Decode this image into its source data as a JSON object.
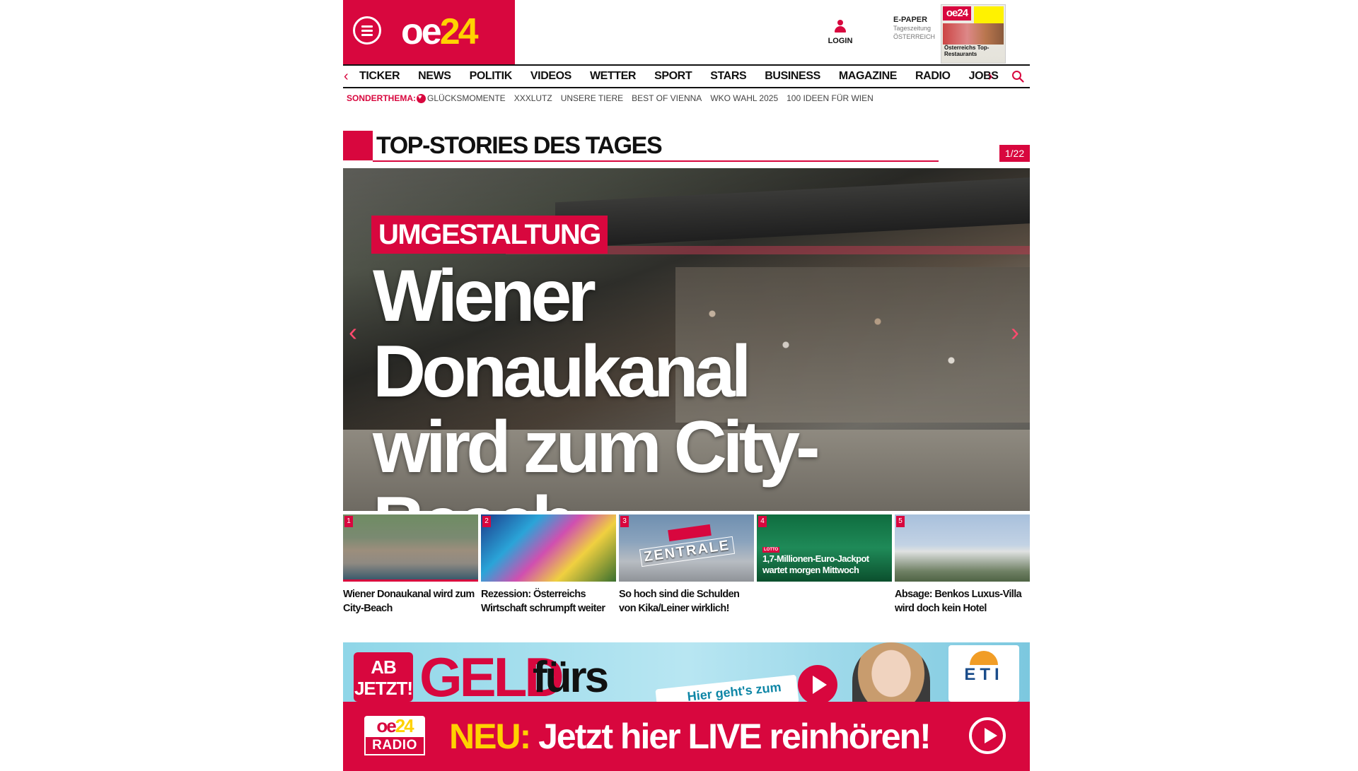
{
  "header": {
    "logo": {
      "part1": "oe",
      "part2": "24"
    },
    "login_label": "LOGIN",
    "epaper": {
      "title": "E-PAPER",
      "line1": "Tageszeitung",
      "line2": "ÖSTERREICH"
    },
    "epaper_cover_logo": "oe24",
    "epaper_cover_headline": "Österreichs Top-Restaurants"
  },
  "nav": {
    "items": [
      "TICKER",
      "NEWS",
      "POLITIK",
      "VIDEOS",
      "WETTER",
      "SPORT",
      "STARS",
      "BUSINESS",
      "MAGAZINE",
      "RADIO",
      "JOBS"
    ]
  },
  "subnav": {
    "label": "SONDERTHEMA:",
    "items": [
      "GLÜCKSMOMENTE",
      "XXXLUTZ",
      "UNSERE TIERE",
      "BEST OF VIENNA",
      "WKO WAHL 2025",
      "100 IDEEN FÜR WIEN"
    ]
  },
  "section": {
    "title": "TOP-STORIES DES TAGES",
    "counter": "1/22"
  },
  "hero": {
    "tag": "UMGESTALTUNG",
    "headline_line1": "Wiener",
    "headline_line2": "Donaukanal",
    "headline_line3": "wird zum City-Beach"
  },
  "thumbs": [
    {
      "num": "1",
      "caption": "Wiener Donaukanal wird zum City-Beach"
    },
    {
      "num": "2",
      "caption": "Rezession: Österreichs Wirtschaft schrumpft weiter"
    },
    {
      "num": "3",
      "caption": "So hoch sind die Schulden von Kika/Leiner wirklich!",
      "image_text": "ZENTRALE"
    },
    {
      "num": "4",
      "caption": "",
      "badge": "LOTTO",
      "overlay_line1": "1,7-Millionen-Euro-Jackpot",
      "overlay_line2": "wartet morgen Mittwoch"
    },
    {
      "num": "5",
      "caption": "Absage: Benkos Luxus-Villa wird doch kein Hotel"
    }
  ],
  "ad": {
    "ab_line1": "AB",
    "ab_line2": "JETZT!",
    "geld": "GELD",
    "fuers": "fürs",
    "cta": "Hier geht's zum",
    "brand": "ETI"
  },
  "radio": {
    "logo_top": "oe",
    "logo_num": "24",
    "logo_bottom": "RADIO",
    "neu": "NEU:",
    "text": "Jetzt hier LIVE reinhören!"
  }
}
